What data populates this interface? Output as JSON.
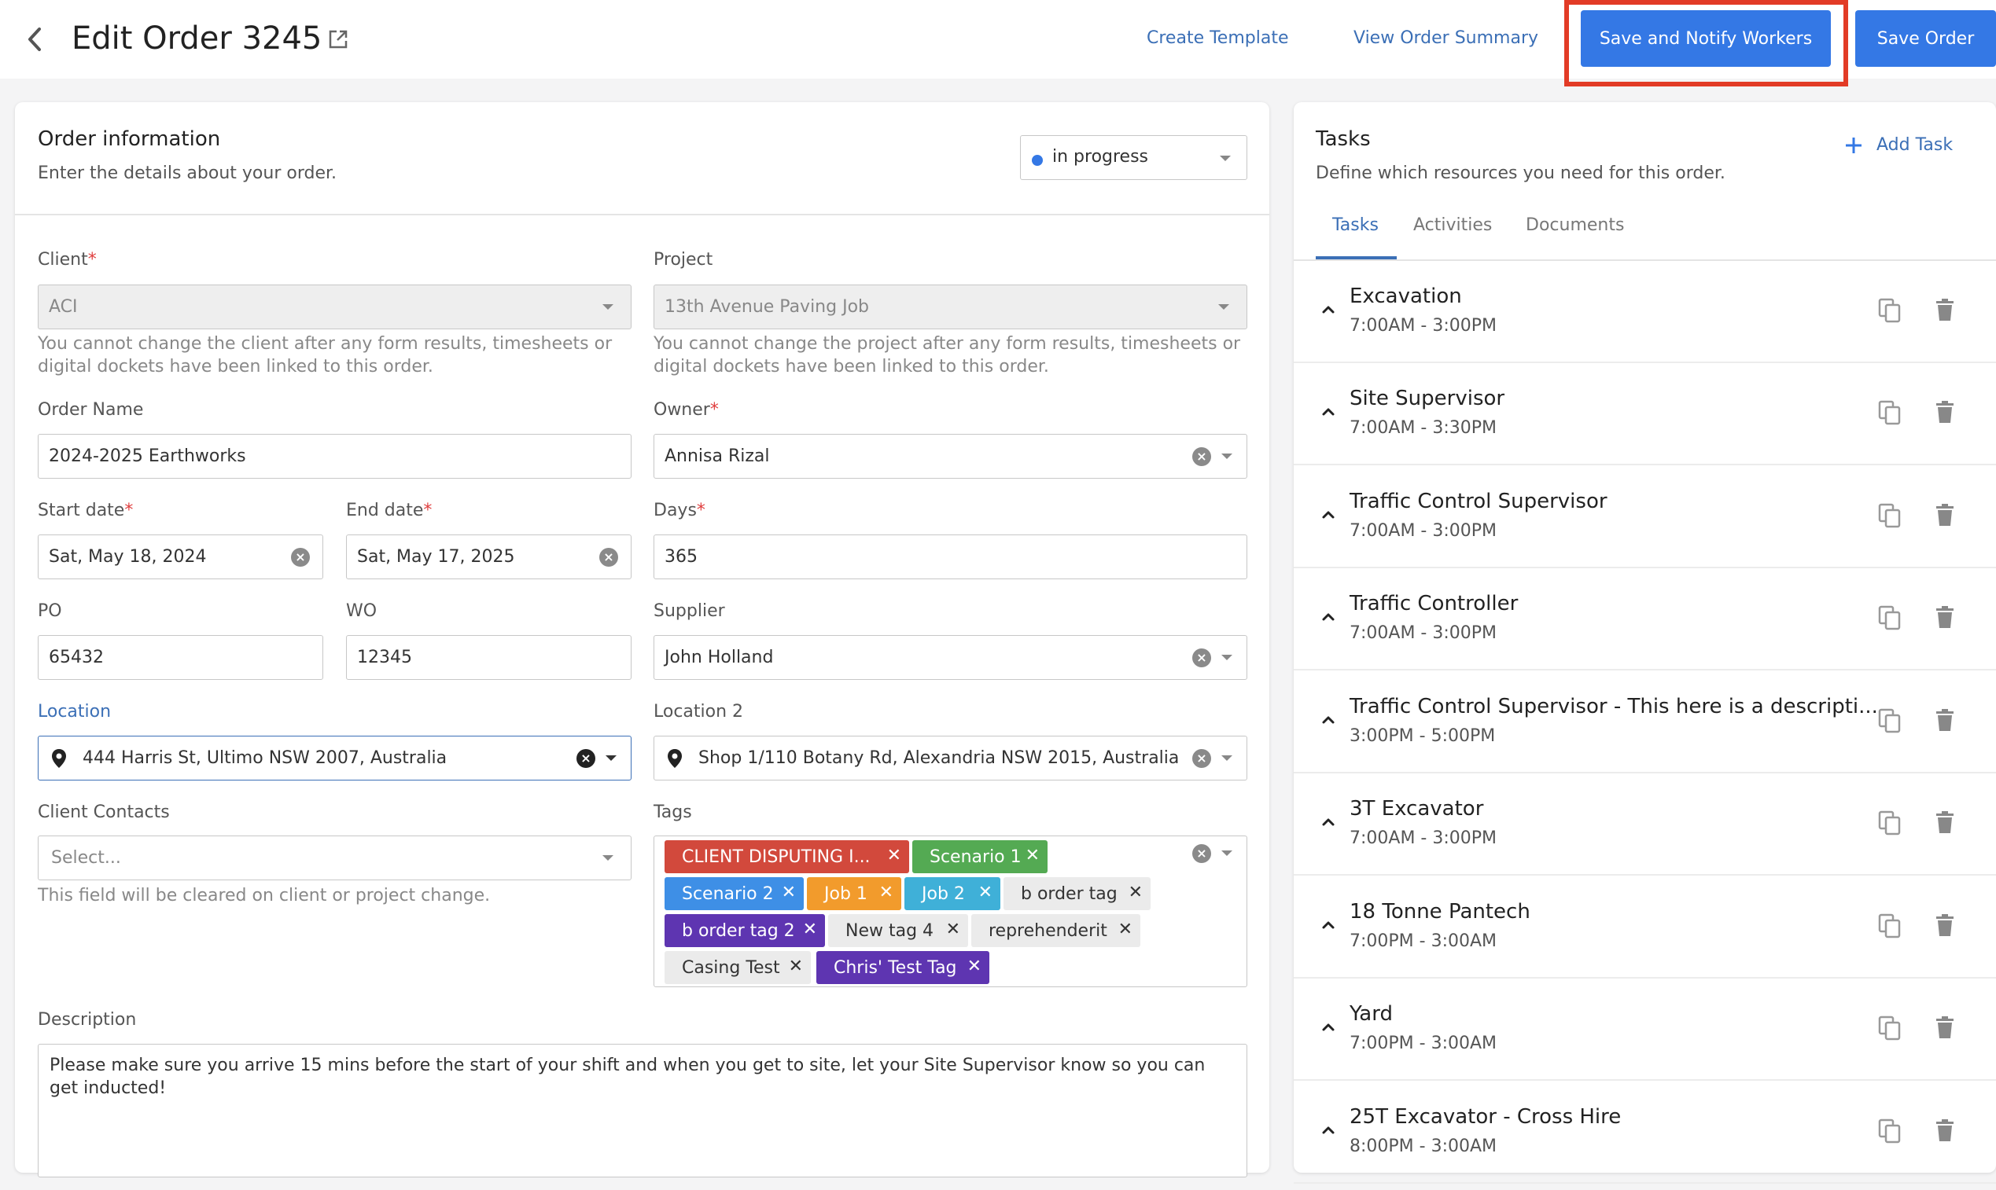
{
  "header": {
    "title": "Edit Order 3245",
    "links": {
      "create_template": "Create Template",
      "view_order_summary": "View Order Summary"
    },
    "buttons": {
      "save_notify": "Save and Notify Workers",
      "save_order": "Save Order"
    }
  },
  "order_info": {
    "title": "Order information",
    "subtitle": "Enter the details about your order.",
    "status": "in progress",
    "client": {
      "label": "Client",
      "value": "ACI",
      "help": "You cannot change the client after any form results, timesheets or digital dockets have been linked to this order."
    },
    "project": {
      "label": "Project",
      "value": "13th Avenue Paving Job",
      "help": "You cannot change the project after any form results, timesheets or digital dockets have been linked to this order."
    },
    "order_name": {
      "label": "Order Name",
      "value": "2024-2025 Earthworks"
    },
    "owner": {
      "label": "Owner",
      "value": "Annisa Rizal"
    },
    "start_date": {
      "label": "Start date",
      "value": "Sat, May 18, 2024"
    },
    "end_date": {
      "label": "End date",
      "value": "Sat, May 17, 2025"
    },
    "days": {
      "label": "Days",
      "value": "365"
    },
    "po": {
      "label": "PO",
      "value": "65432"
    },
    "wo": {
      "label": "WO",
      "value": "12345"
    },
    "supplier": {
      "label": "Supplier",
      "value": "John Holland"
    },
    "location": {
      "label": "Location",
      "value": "444 Harris St, Ultimo NSW 2007, Australia"
    },
    "location2": {
      "label": "Location 2",
      "value": "Shop 1/110 Botany Rd, Alexandria NSW 2015, Australia"
    },
    "client_contacts": {
      "label": "Client Contacts",
      "placeholder": "Select...",
      "help": "This field will be cleared on client or project change."
    },
    "tags_label": "Tags",
    "tags": [
      {
        "label": "CLIENT DISPUTING I...",
        "color": "#d2493c"
      },
      {
        "label": "Scenario 1",
        "color": "#54aa53"
      },
      {
        "label": "Scenario 2",
        "color": "#3e8fe6"
      },
      {
        "label": "Job 1",
        "color": "#f29b2c"
      },
      {
        "label": "Job 2",
        "color": "#3fb0d8"
      },
      {
        "label": "b order tag",
        "color": "#ebebeb"
      },
      {
        "label": "b order tag 2",
        "color": "#5e35b1"
      },
      {
        "label": "New tag 4",
        "color": "#ebebeb"
      },
      {
        "label": "reprehenderit",
        "color": "#ebebeb"
      },
      {
        "label": "Casing Test",
        "color": "#ebebeb"
      },
      {
        "label": "Chris' Test Tag",
        "color": "#5e35b1"
      }
    ],
    "description": {
      "label": "Description",
      "value": "Please make sure you arrive 15 mins before the start of your shift and when you get to site, let your Site Supervisor know so you can get inducted!"
    }
  },
  "tasks_panel": {
    "title": "Tasks",
    "subtitle": "Define which resources you need for this order.",
    "add_task": "Add Task",
    "tabs": [
      "Tasks",
      "Activities",
      "Documents"
    ],
    "tasks": [
      {
        "name": "Excavation",
        "time": "7:00AM - 3:00PM"
      },
      {
        "name": "Site Supervisor",
        "time": "7:00AM - 3:30PM"
      },
      {
        "name": "Traffic Control Supervisor",
        "time": "7:00AM - 3:00PM"
      },
      {
        "name": "Traffic Controller",
        "time": "7:00AM - 3:00PM"
      },
      {
        "name": "Traffic Control Supervisor - This here is a descripti...",
        "time": "3:00PM - 5:00PM"
      },
      {
        "name": "3T Excavator",
        "time": "7:00AM - 3:00PM"
      },
      {
        "name": "18 Tonne Pantech",
        "time": "7:00PM - 3:00AM"
      },
      {
        "name": "Yard",
        "time": "7:00PM - 3:00AM"
      },
      {
        "name": "25T Excavator - Cross Hire",
        "time": "8:00PM - 3:00AM"
      }
    ]
  }
}
